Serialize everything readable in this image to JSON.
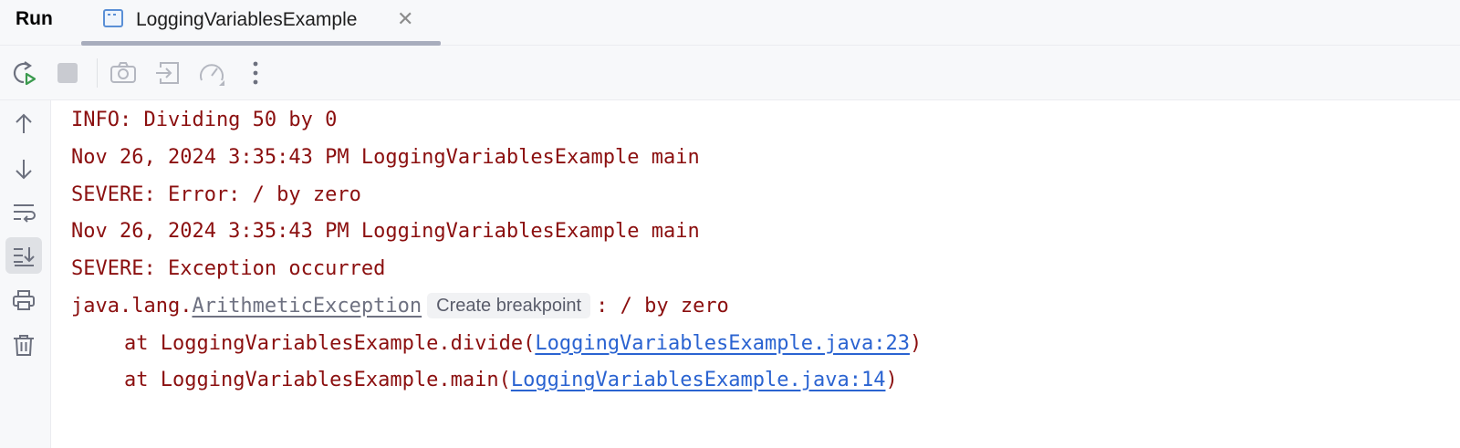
{
  "header": {
    "title": "Run",
    "tab": {
      "label": "LoggingVariablesExample",
      "close_glyph": "✕"
    }
  },
  "toolbar": {
    "buttons": [
      "rerun-icon",
      "stop-icon",
      "camera-icon",
      "exit-icon",
      "speedometer-icon",
      "more-vertical-icon"
    ]
  },
  "sidebar": {
    "buttons": [
      "arrow-up-icon",
      "arrow-down-icon",
      "soft-wrap-icon",
      "scroll-to-end-icon",
      "print-icon",
      "trash-icon"
    ],
    "active": "scroll-to-end-icon"
  },
  "console": {
    "lines": [
      "INFO: Dividing 50 by 0",
      "Nov 26, 2024 3:35:43 PM LoggingVariablesExample main",
      "SEVERE: Error: / by zero",
      "Nov 26, 2024 3:35:43 PM LoggingVariablesExample main",
      "SEVERE: Exception occurred"
    ],
    "exception": {
      "prefix": "java.lang.",
      "class_name": "ArithmeticException",
      "breakpoint_hint": "Create breakpoint",
      "suffix": ": / by zero"
    },
    "stack": [
      {
        "text": "at LoggingVariablesExample.divide(",
        "link": "LoggingVariablesExample.java:23",
        "close": ")"
      },
      {
        "text": "at LoggingVariablesExample.main(",
        "link": "LoggingVariablesExample.java:14",
        "close": ")"
      }
    ]
  },
  "colors": {
    "console_text": "#8b0f0f",
    "link": "#2a63d1",
    "panel_bg": "#f7f8fa"
  }
}
